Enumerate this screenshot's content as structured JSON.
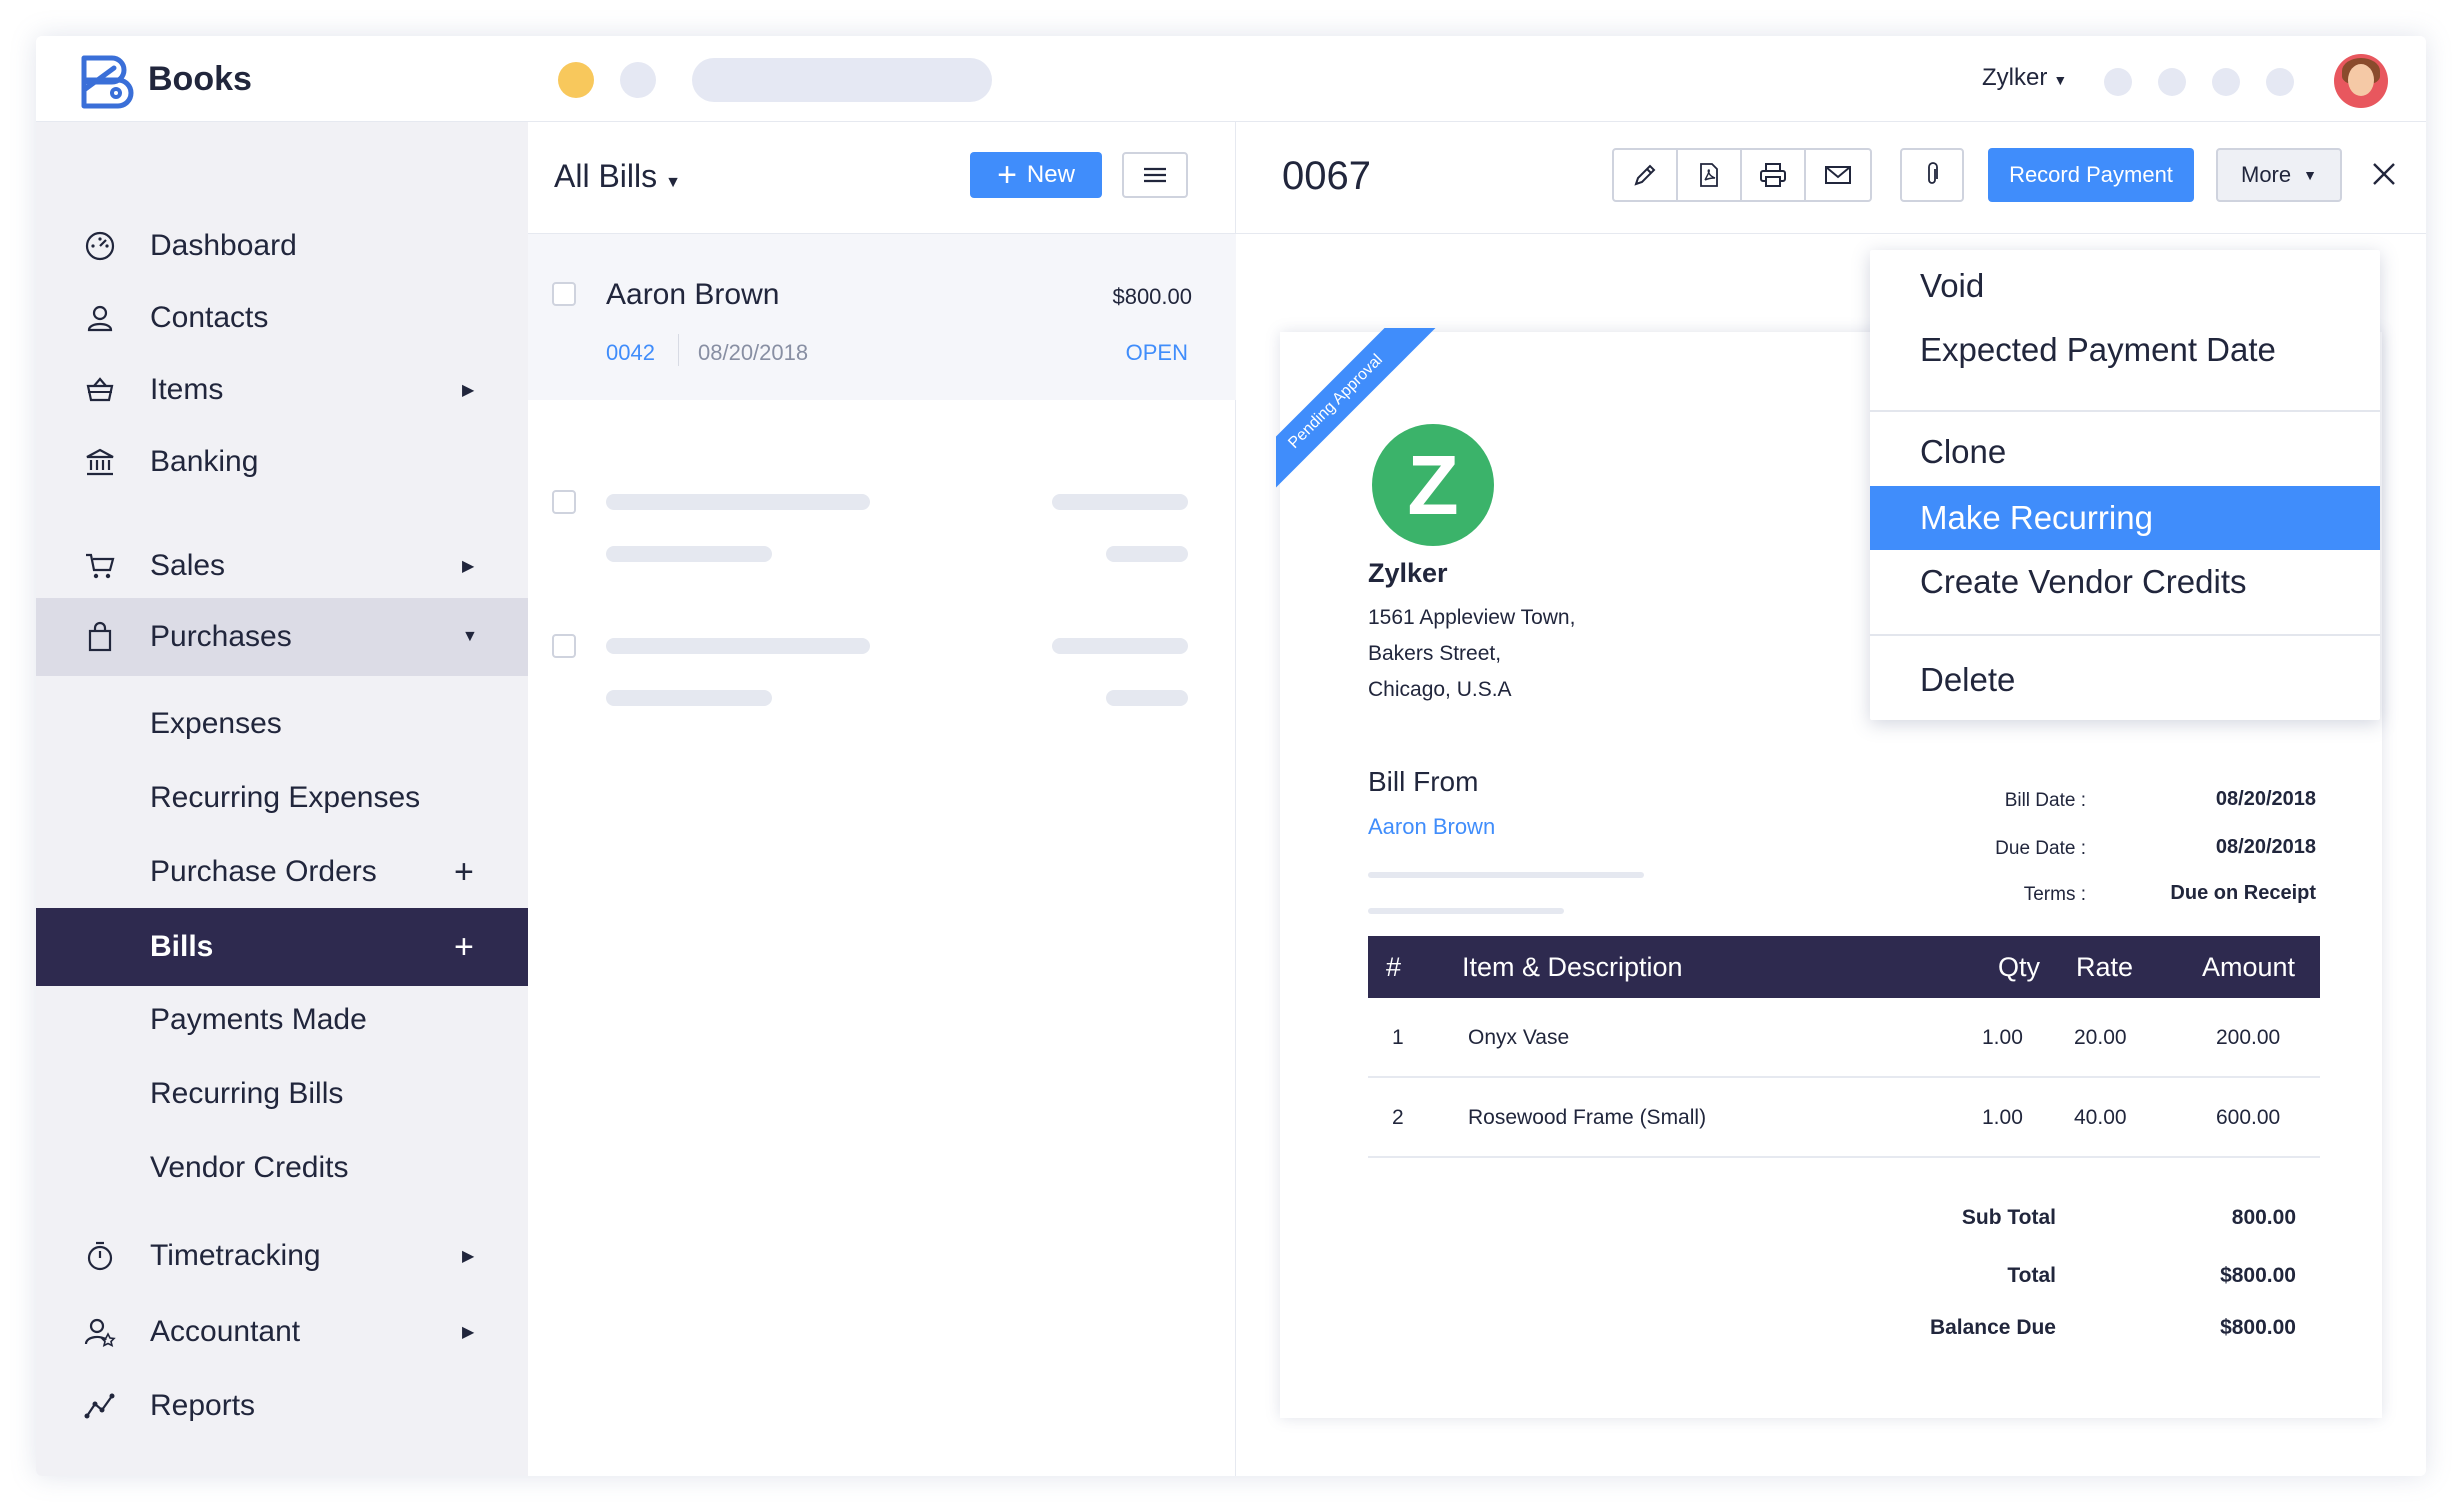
{
  "app": {
    "name": "Books"
  },
  "topbar": {
    "org_name": "Zylker"
  },
  "sidebar": {
    "items": [
      {
        "label": "Dashboard"
      },
      {
        "label": "Contacts"
      },
      {
        "label": "Items"
      },
      {
        "label": "Banking"
      },
      {
        "label": "Sales"
      },
      {
        "label": "Purchases"
      },
      {
        "label": "Expenses"
      },
      {
        "label": "Recurring Expenses"
      },
      {
        "label": "Purchase Orders"
      },
      {
        "label": "Bills"
      },
      {
        "label": "Payments Made"
      },
      {
        "label": "Recurring Bills"
      },
      {
        "label": "Vendor Credits"
      },
      {
        "label": "Timetracking"
      },
      {
        "label": "Accountant"
      },
      {
        "label": "Reports"
      }
    ]
  },
  "list": {
    "title": "All Bills",
    "new_label": "New",
    "bills": [
      {
        "vendor": "Aaron Brown",
        "amount": "$800.00",
        "number": "0042",
        "date": "08/20/2018",
        "status": "OPEN"
      }
    ]
  },
  "detail": {
    "bill_number": "0067",
    "record_payment_label": "Record Payment",
    "more_label": "More",
    "ribbon": "Pending Approval",
    "company": {
      "logo_letter": "Z",
      "name": "Zylker",
      "address_lines": [
        "1561 Appleview Town,",
        "Bakers Street,",
        "Chicago, U.S.A"
      ]
    },
    "bill_from_label": "Bill From",
    "bill_from_name": "Aaron Brown",
    "meta": [
      {
        "label": "Bill Date :",
        "value": "08/20/2018"
      },
      {
        "label": "Due Date :",
        "value": "08/20/2018"
      },
      {
        "label": "Terms :",
        "value": "Due on Receipt"
      }
    ],
    "table": {
      "headers": {
        "num": "#",
        "item": "Item & Description",
        "qty": "Qty",
        "rate": "Rate",
        "amount": "Amount"
      },
      "rows": [
        {
          "num": "1",
          "item": "Onyx Vase",
          "qty": "1.00",
          "rate": "20.00",
          "amount": "200.00"
        },
        {
          "num": "2",
          "item": "Rosewood Frame (Small)",
          "qty": "1.00",
          "rate": "40.00",
          "amount": "600.00"
        }
      ]
    },
    "totals": [
      {
        "label": "Sub Total",
        "value": "800.00"
      },
      {
        "label": "Total",
        "value": "$800.00"
      },
      {
        "label": "Balance Due",
        "value": "$800.00"
      }
    ]
  },
  "more_menu": {
    "items": [
      {
        "label": "Void"
      },
      {
        "label": "Expected Payment Date"
      },
      {
        "label": "Clone"
      },
      {
        "label": "Make Recurring"
      },
      {
        "label": "Create Vendor Credits"
      },
      {
        "label": "Delete"
      }
    ],
    "active_index": 3
  },
  "colors": {
    "accent": "#408dfb",
    "sidebar_active": "#2e2a4f",
    "logo_green": "#3bb36a"
  }
}
